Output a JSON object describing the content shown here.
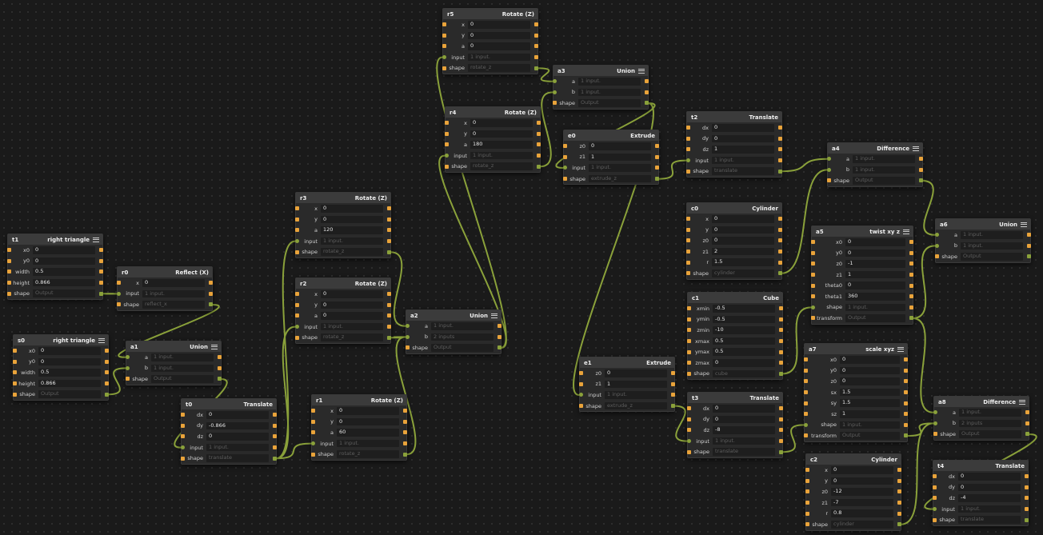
{
  "nodes": [
    {
      "id": "t1",
      "title": "right triangle",
      "menu": true,
      "rows": [
        {
          "label": "x0",
          "value": "0"
        },
        {
          "label": "y0",
          "value": "0"
        },
        {
          "label": "width",
          "value": "0.5"
        },
        {
          "label": "height",
          "value": "0.866"
        },
        {
          "label": "shape",
          "placeholder": "Output"
        }
      ]
    },
    {
      "id": "s0",
      "title": "right triangle",
      "menu": true,
      "rows": [
        {
          "label": "x0",
          "value": "0"
        },
        {
          "label": "y0",
          "value": "0"
        },
        {
          "label": "width",
          "value": "0.5"
        },
        {
          "label": "height",
          "value": "0.866"
        },
        {
          "label": "shape",
          "placeholder": "Output"
        }
      ]
    },
    {
      "id": "r0",
      "title": "Reflect (X)",
      "menu": false,
      "rows": [
        {
          "label": "x",
          "value": "0"
        },
        {
          "label": "input",
          "placeholder": "1 input."
        },
        {
          "label": "shape",
          "placeholder": "reflect_x"
        }
      ]
    },
    {
      "id": "a1",
      "title": "Union",
      "menu": true,
      "rows": [
        {
          "label": "a",
          "placeholder": "1 input."
        },
        {
          "label": "b",
          "placeholder": "1 input."
        },
        {
          "label": "shape",
          "placeholder": "Output"
        }
      ]
    },
    {
      "id": "t0",
      "title": "Translate",
      "menu": false,
      "rows": [
        {
          "label": "dx",
          "value": "0"
        },
        {
          "label": "dy",
          "value": "-0.866"
        },
        {
          "label": "dz",
          "value": "0"
        },
        {
          "label": "input",
          "placeholder": "1 input."
        },
        {
          "label": "shape",
          "placeholder": "translate"
        }
      ]
    },
    {
      "id": "r3",
      "title": "Rotate (Z)",
      "menu": false,
      "rows": [
        {
          "label": "x",
          "value": "0"
        },
        {
          "label": "y",
          "value": "0"
        },
        {
          "label": "a",
          "value": "120"
        },
        {
          "label": "input",
          "placeholder": "1 input."
        },
        {
          "label": "shape",
          "placeholder": "rotate_z"
        }
      ]
    },
    {
      "id": "r2",
      "title": "Rotate (Z)",
      "menu": false,
      "rows": [
        {
          "label": "x",
          "value": "0"
        },
        {
          "label": "y",
          "value": "0"
        },
        {
          "label": "a",
          "value": "0"
        },
        {
          "label": "input",
          "placeholder": "1 input."
        },
        {
          "label": "shape",
          "placeholder": "rotate_z"
        }
      ]
    },
    {
      "id": "r1",
      "title": "Rotate (Z)",
      "menu": false,
      "rows": [
        {
          "label": "x",
          "value": "0"
        },
        {
          "label": "y",
          "value": "0"
        },
        {
          "label": "a",
          "value": "60"
        },
        {
          "label": "input",
          "placeholder": "1 input."
        },
        {
          "label": "shape",
          "placeholder": "rotate_z"
        }
      ]
    },
    {
      "id": "a2",
      "title": "Union",
      "menu": true,
      "rows": [
        {
          "label": "a",
          "placeholder": "1 input."
        },
        {
          "label": "b",
          "placeholder": "2 inputs"
        },
        {
          "label": "shape",
          "placeholder": "Output"
        }
      ]
    },
    {
      "id": "r5",
      "title": "Rotate (Z)",
      "menu": false,
      "rows": [
        {
          "label": "x",
          "value": "0"
        },
        {
          "label": "y",
          "value": "0"
        },
        {
          "label": "a",
          "value": "0"
        },
        {
          "label": "input",
          "placeholder": "1 input."
        },
        {
          "label": "shape",
          "placeholder": "rotate_z"
        }
      ]
    },
    {
      "id": "r4",
      "title": "Rotate (Z)",
      "menu": false,
      "rows": [
        {
          "label": "x",
          "value": "0"
        },
        {
          "label": "y",
          "value": "0"
        },
        {
          "label": "a",
          "value": "180"
        },
        {
          "label": "input",
          "placeholder": "1 input."
        },
        {
          "label": "shape",
          "placeholder": "rotate_z"
        }
      ]
    },
    {
      "id": "a3",
      "title": "Union",
      "menu": true,
      "rows": [
        {
          "label": "a",
          "placeholder": "1 input."
        },
        {
          "label": "b",
          "placeholder": "1 input."
        },
        {
          "label": "shape",
          "placeholder": "Output"
        }
      ]
    },
    {
      "id": "e0",
      "title": "Extrude",
      "menu": false,
      "rows": [
        {
          "label": "z0",
          "value": "0"
        },
        {
          "label": "z1",
          "value": "1"
        },
        {
          "label": "input",
          "placeholder": "1 input."
        },
        {
          "label": "shape",
          "placeholder": "extrude_z"
        }
      ]
    },
    {
      "id": "e1",
      "title": "Extrude",
      "menu": false,
      "rows": [
        {
          "label": "z0",
          "value": "0"
        },
        {
          "label": "z1",
          "value": "1"
        },
        {
          "label": "input",
          "placeholder": "1 input."
        },
        {
          "label": "shape",
          "placeholder": "extrude_z"
        }
      ]
    },
    {
      "id": "t2",
      "title": "Translate",
      "menu": false,
      "rows": [
        {
          "label": "dx",
          "value": "0"
        },
        {
          "label": "dy",
          "value": "0"
        },
        {
          "label": "dz",
          "value": "1"
        },
        {
          "label": "input",
          "placeholder": "1 input."
        },
        {
          "label": "shape",
          "placeholder": "translate"
        }
      ]
    },
    {
      "id": "c0",
      "title": "Cylinder",
      "menu": false,
      "rows": [
        {
          "label": "x",
          "value": "0"
        },
        {
          "label": "y",
          "value": "0"
        },
        {
          "label": "z0",
          "value": "0"
        },
        {
          "label": "z1",
          "value": "2"
        },
        {
          "label": "r",
          "value": "1.5"
        },
        {
          "label": "shape",
          "placeholder": "cylinder"
        }
      ]
    },
    {
      "id": "c1",
      "title": "Cube",
      "menu": false,
      "rows": [
        {
          "label": "xmin",
          "value": "-0.5"
        },
        {
          "label": "ymin",
          "value": "-0.5"
        },
        {
          "label": "zmin",
          "value": "-10"
        },
        {
          "label": "xmax",
          "value": "0.5"
        },
        {
          "label": "ymax",
          "value": "0.5"
        },
        {
          "label": "zmax",
          "value": "0"
        },
        {
          "label": "shape",
          "placeholder": "cube"
        }
      ]
    },
    {
      "id": "t3",
      "title": "Translate",
      "menu": false,
      "rows": [
        {
          "label": "dx",
          "value": "0"
        },
        {
          "label": "dy",
          "value": "0"
        },
        {
          "label": "dz",
          "value": "-8"
        },
        {
          "label": "input",
          "placeholder": "1 input."
        },
        {
          "label": "shape",
          "placeholder": "translate"
        }
      ]
    },
    {
      "id": "a4",
      "title": "Difference",
      "menu": true,
      "rows": [
        {
          "label": "a",
          "placeholder": "1 input."
        },
        {
          "label": "b",
          "placeholder": "1 input."
        },
        {
          "label": "shape",
          "placeholder": "Output"
        }
      ]
    },
    {
      "id": "a5",
      "title": "twist xy z",
      "menu": true,
      "rows": [
        {
          "label": "x0",
          "value": "0"
        },
        {
          "label": "y0",
          "value": "0"
        },
        {
          "label": "z0",
          "value": "-1"
        },
        {
          "label": "z1",
          "value": "1"
        },
        {
          "label": "theta0",
          "value": "0"
        },
        {
          "label": "theta1",
          "value": "360"
        },
        {
          "label": "shape",
          "placeholder": "1 input."
        },
        {
          "label": "transform",
          "placeholder": "Output"
        }
      ]
    },
    {
      "id": "a7",
      "title": "scale xyz",
      "menu": true,
      "rows": [
        {
          "label": "x0",
          "value": "0"
        },
        {
          "label": "y0",
          "value": "0"
        },
        {
          "label": "z0",
          "value": "0"
        },
        {
          "label": "sx",
          "value": "1.5"
        },
        {
          "label": "sy",
          "value": "1.5"
        },
        {
          "label": "sz",
          "value": "1"
        },
        {
          "label": "shape",
          "placeholder": "1 input."
        },
        {
          "label": "transform",
          "placeholder": "Output"
        }
      ]
    },
    {
      "id": "c2",
      "title": "Cylinder",
      "menu": false,
      "rows": [
        {
          "label": "x",
          "value": "0"
        },
        {
          "label": "y",
          "value": "0"
        },
        {
          "label": "z0",
          "value": "-12"
        },
        {
          "label": "z1",
          "value": "-7"
        },
        {
          "label": "r",
          "value": "0.8"
        },
        {
          "label": "shape",
          "placeholder": "cylinder"
        }
      ]
    },
    {
      "id": "a6",
      "title": "Union",
      "menu": true,
      "rows": [
        {
          "label": "a",
          "placeholder": "1 input."
        },
        {
          "label": "b",
          "placeholder": "1 input."
        },
        {
          "label": "shape",
          "placeholder": "Output"
        }
      ]
    },
    {
      "id": "a8",
      "title": "Difference",
      "menu": true,
      "rows": [
        {
          "label": "a",
          "placeholder": "1 input."
        },
        {
          "label": "b",
          "placeholder": "2 inputs"
        },
        {
          "label": "shape",
          "placeholder": "Output"
        }
      ]
    },
    {
      "id": "t4",
      "title": "Translate",
      "menu": false,
      "rows": [
        {
          "label": "dx",
          "value": "0"
        },
        {
          "label": "dy",
          "value": "0"
        },
        {
          "label": "dz",
          "value": "-4"
        },
        {
          "label": "input",
          "placeholder": "1 input."
        },
        {
          "label": "shape",
          "placeholder": "translate"
        }
      ]
    }
  ],
  "connections": [
    {
      "from": "t1",
      "to": "r0.input"
    },
    {
      "from": "r0",
      "to": "a1.a"
    },
    {
      "from": "s0",
      "to": "a1.b"
    },
    {
      "from": "a1",
      "to": "t0.input"
    },
    {
      "from": "t0",
      "to": "r3.input"
    },
    {
      "from": "t0",
      "to": "r2.input"
    },
    {
      "from": "t0",
      "to": "r1.input"
    },
    {
      "from": "r3",
      "to": "a2.a"
    },
    {
      "from": "r2",
      "to": "a2.b"
    },
    {
      "from": "r1",
      "to": "a2.b"
    },
    {
      "from": "a2",
      "to": "r5.input"
    },
    {
      "from": "a2",
      "to": "r4.input"
    },
    {
      "from": "r5",
      "to": "a3.a"
    },
    {
      "from": "r4",
      "to": "a3.b"
    },
    {
      "from": "a3",
      "to": "e0.input"
    },
    {
      "from": "a3",
      "to": "e1.input"
    },
    {
      "from": "e0",
      "to": "t2.input"
    },
    {
      "from": "t2",
      "to": "a4.a"
    },
    {
      "from": "c0",
      "to": "a4.b"
    },
    {
      "from": "a4",
      "to": "a6.a"
    },
    {
      "from": "a5",
      "to": "a6.b"
    },
    {
      "from": "e1",
      "to": "t3.input"
    },
    {
      "from": "c1",
      "to": "a5.shape"
    },
    {
      "from": "t3",
      "to": "a7.shape"
    },
    {
      "from": "a5",
      "to": "a8.a"
    },
    {
      "from": "a7",
      "to": "a8.b"
    },
    {
      "from": "c2",
      "to": "a8.b"
    },
    {
      "from": "a8",
      "to": "t4.input"
    }
  ]
}
